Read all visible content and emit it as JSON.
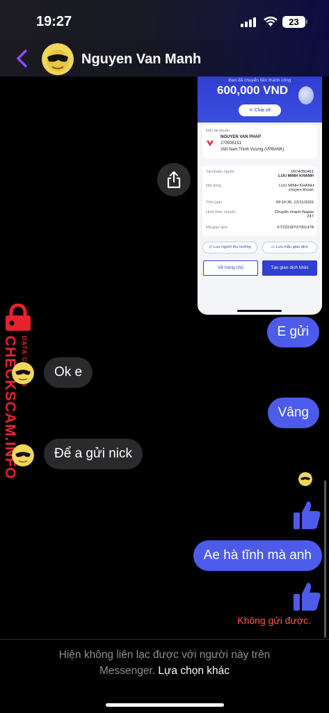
{
  "status_bar": {
    "time": "19:27",
    "battery": "23"
  },
  "header": {
    "contact_name": "Nguyen Van Manh",
    "back_icon": "chevron-left-icon"
  },
  "receipt": {
    "title": "Bạn đã chuyển tiền thành công",
    "amount": "600,000 VND",
    "share_label": "Chia sẻ",
    "to_account_label": "Đến tài khoản",
    "recipient_name": "NGUYEN VAN PHAP",
    "recipient_account": "270535151",
    "recipient_bank": "Việt Nam Thịnh Vượng (VPBANK)",
    "details": [
      {
        "label": "Tài khoản nguồn",
        "value": "0974050461",
        "value2": "LUU MINH KHANH"
      },
      {
        "label": "Nội dung",
        "value": "LUU MINH KHANH",
        "value2": "chuyen khoan"
      },
      {
        "label": "Thời gian",
        "value": "09:10:36, 13/11/2022",
        "value2": ""
      },
      {
        "label": "Hình thức chuyển",
        "value": "Chuyển nhanh Napas",
        "value2": "247"
      },
      {
        "label": "Mã giao dịch",
        "value": "FT22318707001478",
        "value2": ""
      }
    ],
    "save_payee": "Lưu người thụ hưởng",
    "save_template": "Lưu mẫu giao dịch",
    "home_button": "Về trang chủ",
    "new_txn_button": "Tạo giao dịch khác"
  },
  "messages": [
    {
      "side": "out",
      "text": "E gửi"
    },
    {
      "side": "in",
      "text": "Ok e"
    },
    {
      "side": "out",
      "text": "Vâng"
    },
    {
      "side": "in",
      "text": "Để a gửi nick"
    },
    {
      "side": "out",
      "type": "like",
      "icon": "thumbs-up-icon"
    },
    {
      "side": "out",
      "text": "Ae hà tĩnh mà anh"
    },
    {
      "side": "out",
      "type": "like",
      "icon": "thumbs-up-icon"
    }
  ],
  "error_text": "Không gửi được.",
  "watermark": {
    "main": "CHECKSCAM.INFO",
    "sub": "DATA CENTER"
  },
  "footer": {
    "notice": "Hiện không liên lạc được với người này trên",
    "notice2": "Messenger.",
    "link": "Lựa chọn khác"
  },
  "colors": {
    "outgoing_bubble": "#4c5bea",
    "incoming_bubble": "#2a2a2c",
    "accent": "#8a4dff",
    "error": "#ff5a4d",
    "watermark": "#e8222a"
  }
}
